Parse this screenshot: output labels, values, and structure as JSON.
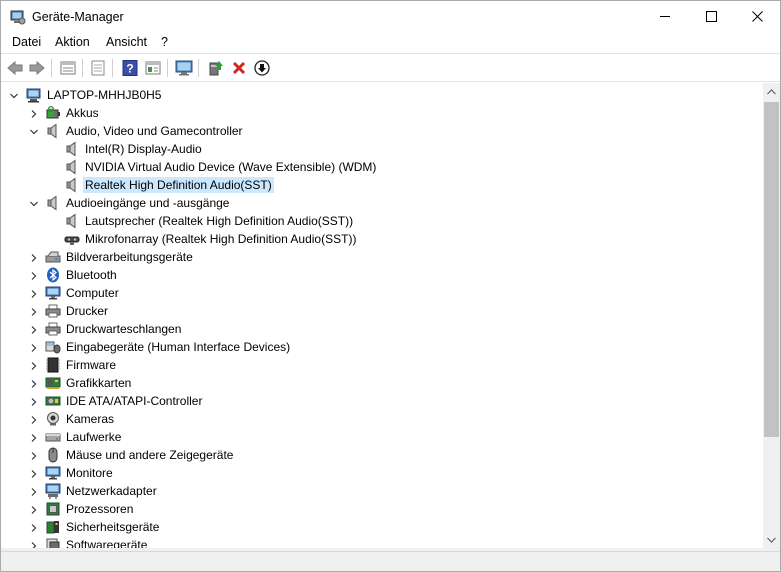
{
  "window": {
    "title": "Geräte-Manager"
  },
  "menu": [
    {
      "label": "Datei"
    },
    {
      "label": "Aktion"
    },
    {
      "label": "Ansicht"
    },
    {
      "label": "?"
    }
  ],
  "toolbar": [
    {
      "icon": "back-arrow-icon",
      "enabled": false
    },
    {
      "icon": "forward-arrow-icon",
      "enabled": false
    },
    {
      "icon": "properties-icon",
      "enabled": true
    },
    {
      "icon": "document-icon",
      "enabled": false
    },
    {
      "icon": "help-icon",
      "enabled": true
    },
    {
      "icon": "view-panel-icon",
      "enabled": true
    },
    {
      "icon": "monitor-scan-icon",
      "enabled": true
    },
    {
      "icon": "update-driver-icon",
      "enabled": true
    },
    {
      "icon": "uninstall-x-icon",
      "enabled": true
    },
    {
      "icon": "disable-device-icon",
      "enabled": true
    }
  ],
  "tree": {
    "root": {
      "label": "LAPTOP-MHHJB0H5",
      "icon": "computer-icon",
      "expanded": true
    },
    "rows": [
      {
        "level": 1,
        "label": "Akkus",
        "icon": "battery-icon",
        "expander": "collapsed"
      },
      {
        "level": 1,
        "label": "Audio, Video und Gamecontroller",
        "icon": "speaker-icon",
        "expander": "expanded"
      },
      {
        "level": 2,
        "label": "Intel(R) Display-Audio",
        "icon": "speaker-icon",
        "expander": "none"
      },
      {
        "level": 2,
        "label": "NVIDIA Virtual Audio Device (Wave Extensible) (WDM)",
        "icon": "speaker-icon",
        "expander": "none"
      },
      {
        "level": 2,
        "label": "Realtek High Definition Audio(SST)",
        "icon": "speaker-icon",
        "expander": "none",
        "selected": true
      },
      {
        "level": 1,
        "label": "Audioeingänge und -ausgänge",
        "icon": "speaker-icon",
        "expander": "expanded"
      },
      {
        "level": 2,
        "label": "Lautsprecher (Realtek High Definition Audio(SST))",
        "icon": "speaker-icon",
        "expander": "none"
      },
      {
        "level": 2,
        "label": "Mikrofonarray (Realtek High Definition Audio(SST))",
        "icon": "microphone-array-icon",
        "expander": "none"
      },
      {
        "level": 1,
        "label": "Bildverarbeitungsgeräte",
        "icon": "imaging-device-icon",
        "expander": "collapsed"
      },
      {
        "level": 1,
        "label": "Bluetooth",
        "icon": "bluetooth-icon",
        "expander": "collapsed"
      },
      {
        "level": 1,
        "label": "Computer",
        "icon": "monitor-icon",
        "expander": "collapsed"
      },
      {
        "level": 1,
        "label": "Drucker",
        "icon": "printer-icon",
        "expander": "collapsed"
      },
      {
        "level": 1,
        "label": "Druckwarteschlangen",
        "icon": "printer-icon",
        "expander": "collapsed"
      },
      {
        "level": 1,
        "label": "Eingabegeräte (Human Interface Devices)",
        "icon": "hid-icon",
        "expander": "collapsed"
      },
      {
        "level": 1,
        "label": "Firmware",
        "icon": "firmware-icon",
        "expander": "collapsed"
      },
      {
        "level": 1,
        "label": "Grafikkarten",
        "icon": "display-adapter-icon",
        "expander": "collapsed"
      },
      {
        "level": 1,
        "label": "IDE ATA/ATAPI-Controller",
        "icon": "ide-controller-icon",
        "expander": "collapsed"
      },
      {
        "level": 1,
        "label": "Kameras",
        "icon": "camera-icon",
        "expander": "collapsed"
      },
      {
        "level": 1,
        "label": "Laufwerke",
        "icon": "drive-icon",
        "expander": "collapsed"
      },
      {
        "level": 1,
        "label": "Mäuse und andere Zeigegeräte",
        "icon": "mouse-icon",
        "expander": "collapsed"
      },
      {
        "level": 1,
        "label": "Monitore",
        "icon": "monitor-icon",
        "expander": "collapsed"
      },
      {
        "level": 1,
        "label": "Netzwerkadapter",
        "icon": "network-adapter-icon",
        "expander": "collapsed"
      },
      {
        "level": 1,
        "label": "Prozessoren",
        "icon": "processor-icon",
        "expander": "collapsed"
      },
      {
        "level": 1,
        "label": "Sicherheitsgeräte",
        "icon": "security-device-icon",
        "expander": "collapsed"
      },
      {
        "level": 1,
        "label": "Softwaregeräte",
        "icon": "software-device-icon",
        "expander": "collapsed"
      }
    ]
  },
  "colors": {
    "selection": "#cce8ff",
    "uninstall_red": "#d42323",
    "update_green": "#2f9e3a"
  }
}
